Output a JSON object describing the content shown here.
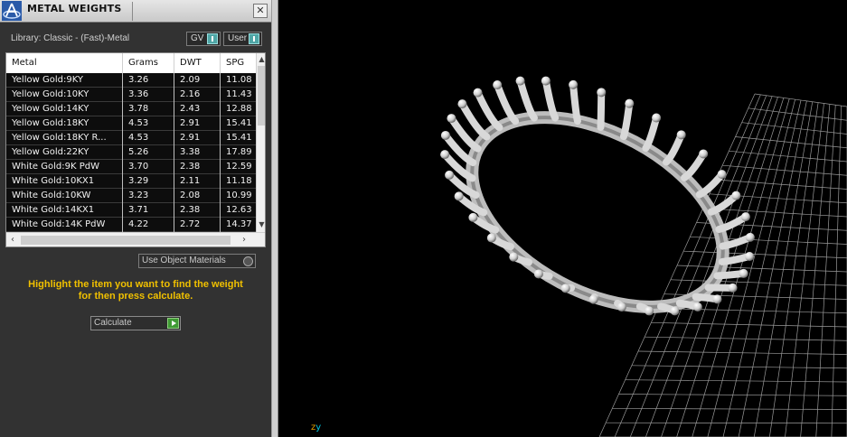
{
  "panel": {
    "title": "METAL WEIGHTS",
    "close_symbol": "✕",
    "library_label": "Library: Classic - (Fast)-Metal",
    "toggles": [
      {
        "label": "GV"
      },
      {
        "label": "User"
      }
    ],
    "use_object_materials_label": "Use Object Materials",
    "hint_line1": "Highlight the item you want to find the weight",
    "hint_line2": "for then press calculate.",
    "calculate_label": "Calculate"
  },
  "table": {
    "columns": [
      "Metal",
      "Grams",
      "DWT",
      "SPG"
    ],
    "rows": [
      [
        "Yellow Gold:9KY",
        "3.26",
        "2.09",
        "11.08"
      ],
      [
        "Yellow Gold:10KY",
        "3.36",
        "2.16",
        "11.43"
      ],
      [
        "Yellow Gold:14KY",
        "3.78",
        "2.43",
        "12.88"
      ],
      [
        "Yellow Gold:18KY",
        "4.53",
        "2.91",
        "15.41"
      ],
      [
        "Yellow Gold:18KY R...",
        "4.53",
        "2.91",
        "15.41"
      ],
      [
        "Yellow Gold:22KY",
        "5.26",
        "3.38",
        "17.89"
      ],
      [
        "White Gold:9K PdW",
        "3.70",
        "2.38",
        "12.59"
      ],
      [
        "White Gold:10KX1",
        "3.29",
        "2.11",
        "11.18"
      ],
      [
        "White Gold:10KW",
        "3.23",
        "2.08",
        "10.99"
      ],
      [
        "White Gold:14KX1",
        "3.71",
        "2.38",
        "12.63"
      ],
      [
        "White Gold:14K PdW",
        "4.22",
        "2.72",
        "14.37"
      ]
    ]
  },
  "viewport": {
    "axis_z": "z",
    "axis_y": "y"
  },
  "colors": {
    "hint": "#f0c000",
    "axis_z": "#e0a000",
    "axis_y": "#00c8e0"
  }
}
